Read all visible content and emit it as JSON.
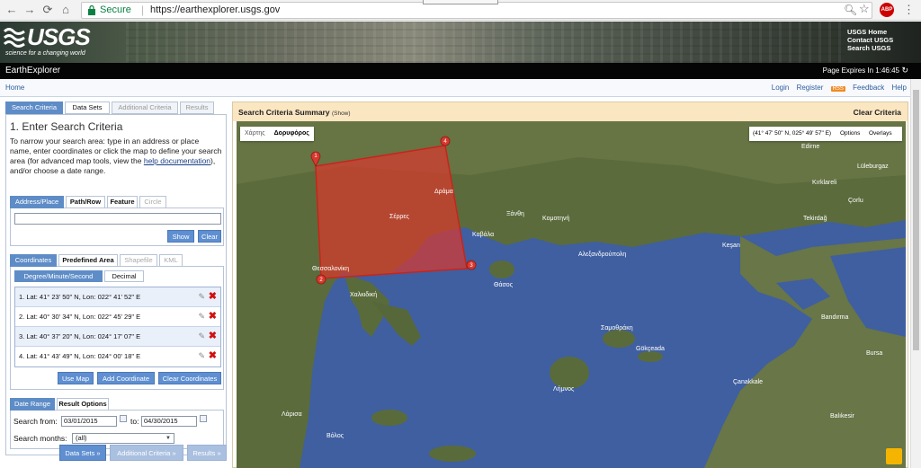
{
  "browser": {
    "secure_label": "Secure",
    "url": "https://earthexplorer.usgs.gov"
  },
  "banner": {
    "logo_text": "USGS",
    "tagline": "science for a changing world",
    "links": [
      "USGS Home",
      "Contact USGS",
      "Search USGS"
    ]
  },
  "titlebar": {
    "title": "EarthExplorer",
    "expires": "Page Expires In 1:46:45"
  },
  "nav": {
    "home": "Home",
    "login": "Login",
    "register": "Register",
    "rss": "RSS",
    "feedback": "Feedback",
    "help": "Help"
  },
  "main_tabs": [
    "Search Criteria",
    "Data Sets",
    "Additional Criteria",
    "Results"
  ],
  "criteria": {
    "heading": "1. Enter Search Criteria",
    "desc_1": "To narrow your search area: type in an address or place name, enter coordinates or click the map to define your search area (for advanced map tools, view the",
    "help_link": "help documentation",
    "desc_2": "), and/or choose a date range."
  },
  "address": {
    "tabs": [
      "Address/Place",
      "Path/Row",
      "Feature",
      "Circle"
    ],
    "input_value": "",
    "show_button": "Show",
    "clear_button": "Clear"
  },
  "coordinates": {
    "tabs": [
      "Coordinates",
      "Predefined Area",
      "Shapefile",
      "KML"
    ],
    "format_tabs": [
      "Degree/Minute/Second",
      "Decimal"
    ],
    "rows": [
      "1.  Lat: 41° 23' 50\" N, Lon: 022° 41' 52\" E",
      "2.  Lat: 40° 30' 34\" N, Lon: 022° 45' 29\" E",
      "3.  Lat: 40° 37' 20\" N, Lon: 024° 17' 07\" E",
      "4.  Lat: 41° 43' 49\" N, Lon: 024° 00' 18\" E"
    ],
    "use_map": "Use Map",
    "add_coordinate": "Add Coordinate",
    "clear_coordinates": "Clear Coordinates"
  },
  "dates": {
    "tabs": [
      "Date Range",
      "Result Options"
    ],
    "search_from_label": "Search from:",
    "from_value": "03/01/2015",
    "to_label": "to:",
    "to_value": "04/30/2015",
    "months_label": "Search months:",
    "months_value": "(all)"
  },
  "bottom_nav": [
    "Data Sets »",
    "Additional Criteria »",
    "Results »"
  ],
  "summary": {
    "title": "Search Criteria Summary",
    "show": "(Show)",
    "clear": "Clear Criteria"
  },
  "map": {
    "map_type": [
      "Χάρτης",
      "Δορυφόρος"
    ],
    "coords": "(41° 47' 50\" N, 025° 49' 57\" E)",
    "options": "Options",
    "overlays": "Overlays",
    "markers": [
      "1",
      "2",
      "3",
      "4"
    ],
    "labels": [
      "Θεσσαλονίκη",
      "Καβάλα",
      "Ξάνθη",
      "Αλεξανδρούπολη",
      "Κομοτηνή",
      "Σέρρες",
      "Δράμα",
      "Λάρισα",
      "Βόλος",
      "Çanakkale",
      "Edirne",
      "Tekirdağ",
      "Balıkesir",
      "Kırklareli",
      "Bandırma",
      "Χαλκιδική",
      "Θάσος",
      "Σαμοθράκη",
      "Λήμνος",
      "Gökçeada",
      "Keşan",
      "Lüleburgaz",
      "Çorlu",
      "Bursa"
    ]
  },
  "colors": {
    "accent": "#5e8cc7",
    "summary_bg": "#fbe6c2",
    "selection": "#d8392e"
  }
}
